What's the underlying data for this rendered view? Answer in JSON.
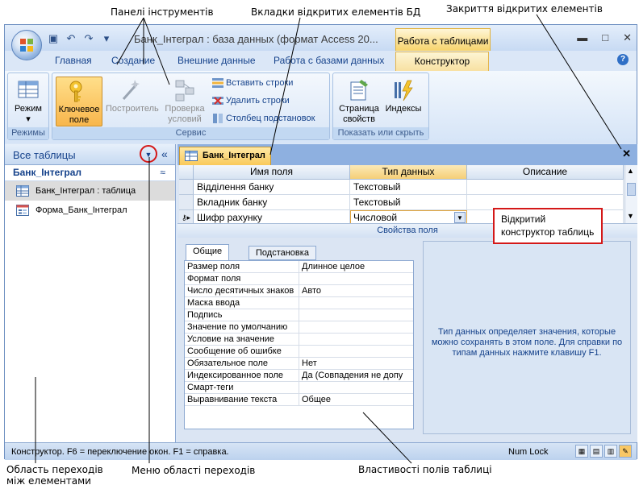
{
  "annotations": {
    "toolbars": "Панелі інструментів",
    "db_tabs": "Вкладки відкритих елементів БД",
    "close_open": "Закриття відкритих елементів",
    "table_designer_line1": "Відкритий",
    "table_designer_line2": "конструктор таблиць",
    "nav_area_line1": "Область переходів",
    "nav_area_line2": "між елементами",
    "nav_menu": "Меню області переходів",
    "field_props": "Властивості полів таблиці"
  },
  "window": {
    "title": "Банк_Інтеграл : база данных (формат Access 20...",
    "context_tab": "Работа с таблицами",
    "minimize": "▬",
    "maximize": "□",
    "close": "✕"
  },
  "tabs": [
    "Главная",
    "Создание",
    "Внешние данные",
    "Работа с базами данных",
    "Конструктор"
  ],
  "ribbon": {
    "views_group": "Режимы",
    "view_btn_line1": "Режим",
    "view_btn_line2": "▾",
    "tools_group": "Сервис",
    "key_btn_line1": "Ключевое",
    "key_btn_line2": "поле",
    "builder_btn": "Построитель",
    "check_btn_line1": "Проверка",
    "check_btn_line2": "условий",
    "insert_rows": "Вставить строки",
    "delete_rows": "Удалить строки",
    "lookup_col": "Столбец подстановок",
    "show_group": "Показать или скрыть",
    "prop_sheet_line1": "Страница",
    "prop_sheet_line2": "свойств",
    "indexes_btn": "Индексы"
  },
  "nav": {
    "title": "Все таблицы",
    "group": "Банк_Інтеграл",
    "items": [
      {
        "label": "Банк_Інтеграл : таблица",
        "icon": "table-icon"
      },
      {
        "label": "Форма_Банк_Інтеграл",
        "icon": "form-icon"
      }
    ]
  },
  "document": {
    "tab_label": "Банк_Інтеграл",
    "close": "✕",
    "columns": [
      "Имя поля",
      "Тип данных",
      "Описание"
    ],
    "rows": [
      {
        "name": "Відділення банку",
        "type": "Текстовый",
        "desc": ""
      },
      {
        "name": "Вкладник банку",
        "type": "Текстовый",
        "desc": ""
      },
      {
        "name": "Шифр рахунку",
        "type": "Числовой",
        "desc": ""
      }
    ],
    "props_header": "Свойства поля",
    "props_tabs": [
      "Общие",
      "Подстановка"
    ],
    "props": [
      {
        "label": "Размер поля",
        "value": "Длинное целое"
      },
      {
        "label": "Формат поля",
        "value": ""
      },
      {
        "label": "Число десятичных знаков",
        "value": "Авто"
      },
      {
        "label": "Маска ввода",
        "value": ""
      },
      {
        "label": "Подпись",
        "value": ""
      },
      {
        "label": "Значение по умолчанию",
        "value": ""
      },
      {
        "label": "Условие на значение",
        "value": ""
      },
      {
        "label": "Сообщение об ошибке",
        "value": ""
      },
      {
        "label": "Обязательное поле",
        "value": "Нет"
      },
      {
        "label": "Индексированное поле",
        "value": "Да (Совпадения не допу"
      },
      {
        "label": "Смарт-теги",
        "value": ""
      },
      {
        "label": "Выравнивание текста",
        "value": "Общее"
      }
    ],
    "hint": "Тип данных определяет значения, которые можно сохранять в этом поле.  Для справки по типам данных нажмите клавишу F1."
  },
  "status": {
    "text": "Конструктор.  F6 = переключение окон.  F1 = справка.",
    "numlock": "Num Lock"
  },
  "colors": {
    "accent": "#f8c765",
    "callout": "#d41818",
    "frame": "#6c8ec0"
  }
}
